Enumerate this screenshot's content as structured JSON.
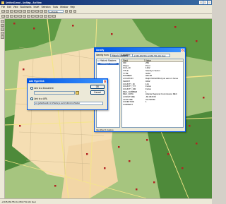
{
  "app": {
    "title": "Untitled3.mxd - ArcMap - ArcView"
  },
  "menu": [
    "File",
    "Edit",
    "View",
    "Bookmarks",
    "Insert",
    "Selection",
    "Tools",
    "Window",
    "Help"
  ],
  "toolbar": {
    "scale": "1:25,046"
  },
  "identify": {
    "title": "Identify",
    "identify_from_label": "Identify from:",
    "identify_from_value": "Historic Markers",
    "location_label": "Location:",
    "location_value": "-2,043,281.551  12,063,731.441 Feet",
    "tree_parent": "Historic Markers",
    "tree_child": "Stanley's Sector",
    "field_header": "Field",
    "value_header": "Value",
    "fields": [
      {
        "name": "FID",
        "value": "259"
      },
      {
        "name": "Shape",
        "value": "Point"
      },
      {
        "name": "GCA_ID",
        "value": "1262"
      },
      {
        "name": "TITLE",
        "value": "Stanley's Sector"
      },
      {
        "name": "TYPE",
        "value": "GHM"
      },
      {
        "name": "NUMBER",
        "value": "060-68"
      },
      {
        "name": "LOCATION",
        "value": "Ralph McGill Blvd just east of Jones"
      },
      {
        "name": "SHORT",
        "value": "0442"
      },
      {
        "name": "COUNTY_ID",
        "value": "121"
      },
      {
        "name": "COUNTY_TIT",
        "value": "Fulton"
      },
      {
        "name": "COUNTY_NM",
        "value": "Fulton"
      },
      {
        "name": "REC_NUMBER",
        "value": "1"
      },
      {
        "name": "REC_DATA",
        "value": "Atlanta Regional Commission REC"
      },
      {
        "name": "LONGITUDE",
        "value": "-84.364729"
      },
      {
        "name": "LATITUDE",
        "value": "33.768780"
      },
      {
        "name": "CONDITION",
        "value": "1"
      },
      {
        "name": "CURRENT",
        "value": ""
      }
    ],
    "status": "Identified 1 feature"
  },
  "hyperlink": {
    "title": "Add Hyperlink",
    "doc_label": "Link to a Document",
    "doc_value": "",
    "url_label": "Link to a URL",
    "url_value": "en.gadetidewalk.com/Stanleys-sector/Historical-Marker",
    "ok_label": "OK",
    "cancel_label": "Cancel"
  },
  "status": {
    "coords": "-2,045,364.551  12,063,731.441 Feet"
  },
  "colors": {
    "map_green": "#a6c57f",
    "dark_green": "#4e8a3a",
    "city_tan": "#f5deb3",
    "roads": "#f5e68a",
    "markers": "#b22222"
  }
}
